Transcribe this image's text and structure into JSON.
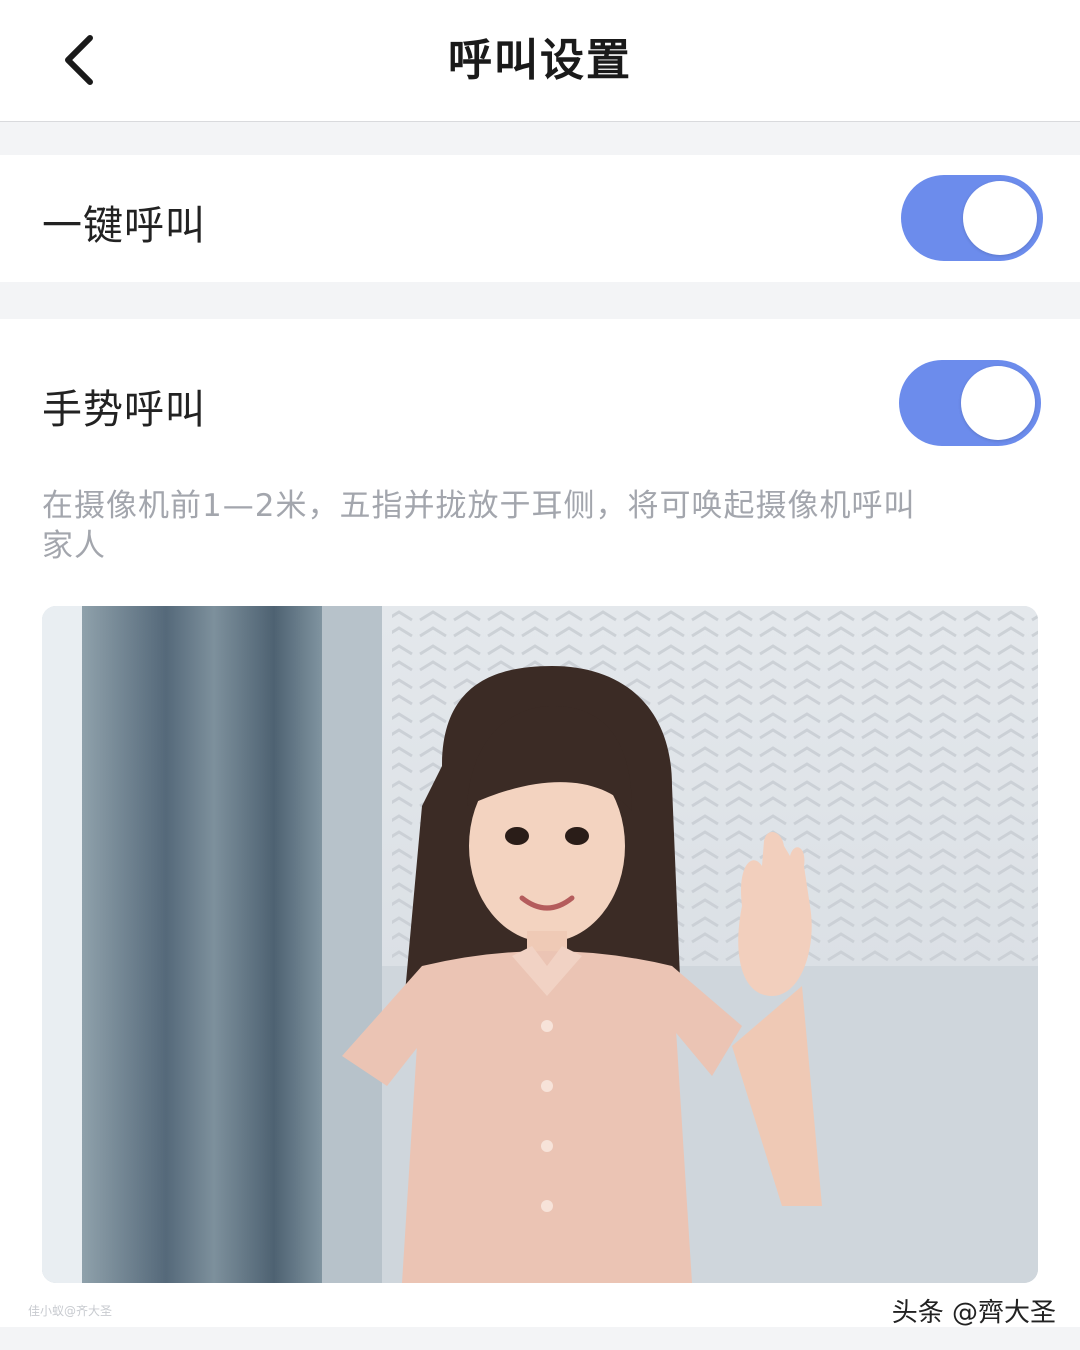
{
  "nav": {
    "title": "呼叫设置"
  },
  "settings": {
    "one_key_call": {
      "label": "一键呼叫",
      "enabled": true
    },
    "gesture_call": {
      "label": "手势呼叫",
      "enabled": true,
      "description": "在摄像机前1—2米，五指并拢放于耳侧，将可唤起摄像机呼叫家人"
    }
  },
  "colors": {
    "accent": "#6c8cec",
    "background": "#f3f4f6",
    "hint_text": "#a3a6ad"
  },
  "icons": {
    "back": "chevron-left-icon"
  },
  "watermark": {
    "left": "佳小蚁@齐大圣",
    "right": "头条 @齊大圣"
  }
}
